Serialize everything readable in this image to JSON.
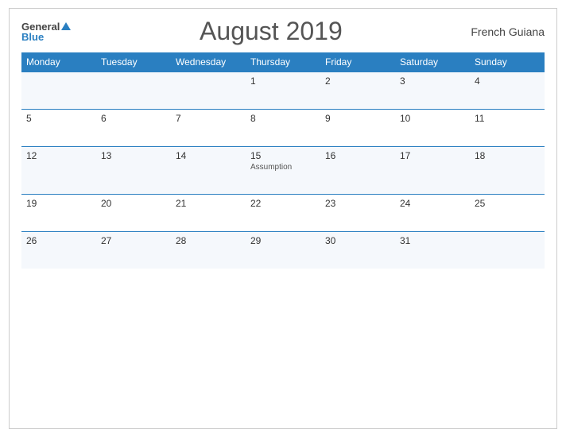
{
  "header": {
    "logo_general": "General",
    "logo_blue": "Blue",
    "month_title": "August 2019",
    "region": "French Guiana"
  },
  "weekdays": [
    "Monday",
    "Tuesday",
    "Wednesday",
    "Thursday",
    "Friday",
    "Saturday",
    "Sunday"
  ],
  "weeks": [
    [
      {
        "day": "",
        "holiday": ""
      },
      {
        "day": "",
        "holiday": ""
      },
      {
        "day": "",
        "holiday": ""
      },
      {
        "day": "1",
        "holiday": ""
      },
      {
        "day": "2",
        "holiday": ""
      },
      {
        "day": "3",
        "holiday": ""
      },
      {
        "day": "4",
        "holiday": ""
      }
    ],
    [
      {
        "day": "5",
        "holiday": ""
      },
      {
        "day": "6",
        "holiday": ""
      },
      {
        "day": "7",
        "holiday": ""
      },
      {
        "day": "8",
        "holiday": ""
      },
      {
        "day": "9",
        "holiday": ""
      },
      {
        "day": "10",
        "holiday": ""
      },
      {
        "day": "11",
        "holiday": ""
      }
    ],
    [
      {
        "day": "12",
        "holiday": ""
      },
      {
        "day": "13",
        "holiday": ""
      },
      {
        "day": "14",
        "holiday": ""
      },
      {
        "day": "15",
        "holiday": "Assumption"
      },
      {
        "day": "16",
        "holiday": ""
      },
      {
        "day": "17",
        "holiday": ""
      },
      {
        "day": "18",
        "holiday": ""
      }
    ],
    [
      {
        "day": "19",
        "holiday": ""
      },
      {
        "day": "20",
        "holiday": ""
      },
      {
        "day": "21",
        "holiday": ""
      },
      {
        "day": "22",
        "holiday": ""
      },
      {
        "day": "23",
        "holiday": ""
      },
      {
        "day": "24",
        "holiday": ""
      },
      {
        "day": "25",
        "holiday": ""
      }
    ],
    [
      {
        "day": "26",
        "holiday": ""
      },
      {
        "day": "27",
        "holiday": ""
      },
      {
        "day": "28",
        "holiday": ""
      },
      {
        "day": "29",
        "holiday": ""
      },
      {
        "day": "30",
        "holiday": ""
      },
      {
        "day": "31",
        "holiday": ""
      },
      {
        "day": "",
        "holiday": ""
      }
    ]
  ]
}
